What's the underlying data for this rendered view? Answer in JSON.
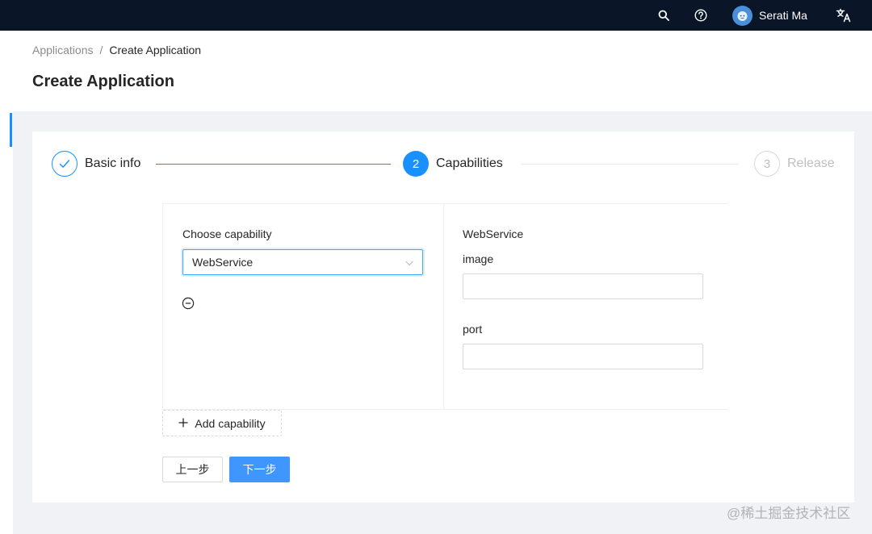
{
  "breadcrumb": {
    "root": "Applications",
    "separator": "/",
    "current": "Create Application"
  },
  "page": {
    "title": "Create Application"
  },
  "header": {
    "user_name": "Serati Ma",
    "icons": [
      "search-icon",
      "help-icon",
      "avatar",
      "translate-icon"
    ]
  },
  "steps": [
    {
      "number": "1",
      "label": "Basic info",
      "status": "finished"
    },
    {
      "number": "2",
      "label": "Capabilities",
      "status": "active"
    },
    {
      "number": "3",
      "label": "Release",
      "status": "waiting"
    }
  ],
  "capability": {
    "choose_label": "Choose capability",
    "selected": "WebService",
    "detail_title": "WebService",
    "fields": [
      {
        "label": "image",
        "value": ""
      },
      {
        "label": "port",
        "value": ""
      }
    ],
    "add_label": "Add capability"
  },
  "actions": {
    "prev": "上一步",
    "next": "下一步"
  },
  "watermark": "@稀土掘金技术社区",
  "colors": {
    "topbar": "#0b1528",
    "primary": "#1890ff",
    "background": "#f0f2f5"
  }
}
